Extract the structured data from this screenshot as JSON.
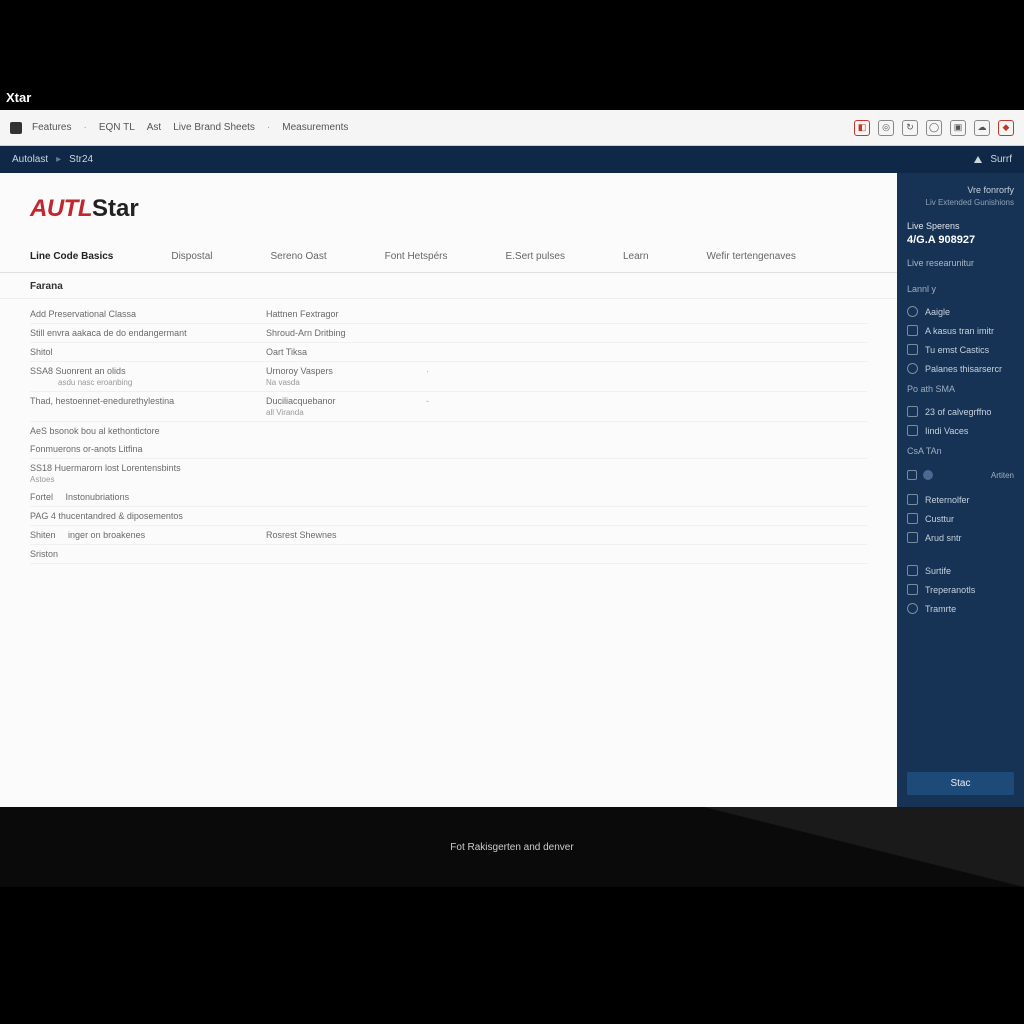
{
  "browser_tab": "Xtar",
  "toolbar": {
    "crumbs": [
      "Features",
      "EQN TL",
      "Ast",
      "Live Brand Sheets",
      "Measurements"
    ],
    "icons": [
      "doc-icon",
      "target-icon",
      "refresh-icon",
      "hex-icon",
      "layers-icon",
      "cloud-icon",
      "diamond-icon"
    ]
  },
  "darkbar": {
    "left1": "Autolast",
    "left2": "Str24",
    "right": "Surrf"
  },
  "brand": {
    "red": "AUTL",
    "rest": "Star"
  },
  "tabs": [
    "Line Code Basics",
    "Dispostal",
    "Sereno Oast",
    "Font Hetspérs",
    "E.Sert pulses",
    "Learn",
    "Wefir tertengenaves"
  ],
  "section_title": "Farana",
  "rows": [
    {
      "c1": "Add Preservational Classa",
      "c2": "Hattnen Fextragor"
    },
    {
      "c1": "Still envra aakaca de do endangermant",
      "c2": "Shroud-Arn Dritbing"
    },
    {
      "c1": "Shitol",
      "c2": "Oart Tiksa"
    },
    {
      "c1": "SSA8 Suonrent an olids",
      "c2": "Urnoroy Vaspers",
      "c3": "·",
      "sub1": "asdu nasc eroanbing",
      "sub2": "Na vasda"
    },
    {
      "c1": "Thad, hestoennet-enedurethylestina",
      "c2": "Duciliacquebanor",
      "c3": "-",
      "sub2": "all Viranda"
    },
    {
      "c1": "AeS bsonok bou al kethontictore"
    },
    {
      "c1": "Fonmuerons or-anots Litfina"
    },
    {
      "c1": "SS18 Huermarorn lost Lorentensbints",
      "sub1": "Astoes"
    },
    {
      "c1_a": "Fortel",
      "c1_b": "Instonubriations"
    },
    {
      "c1": "PAG 4 thucentandred & diposementos"
    },
    {
      "c1_a": "Shiten",
      "c1_b": "inger on broakenes",
      "c2": "Rosrest Shewnes"
    },
    {
      "c1": "Sriston"
    }
  ],
  "sidebar": {
    "top1": "Vre fonrorfy",
    "top2": "Liv Extended Gunishions",
    "head": "Live Sperens",
    "big": "4/G.A 908927",
    "row1": "Live researunitur",
    "group1": "Lannl y",
    "items1": [
      "Aaigle",
      "A kasus tran imitr",
      "Tu emst Castics",
      "Palanes thisarsercr"
    ],
    "group2": "Po ath SMA",
    "items2": [
      "23 of calvegrffno",
      "Iindi Vaces"
    ],
    "group3": "CsA TAn",
    "action": "Artiten",
    "items3": [
      "Reternolfer",
      "Custtur",
      "Arud sntr"
    ],
    "items4": [
      "Surtife",
      "Treperanotls",
      "Tramrte"
    ],
    "save": "Stac"
  },
  "footer": "Fot Rakisgerten and denver"
}
